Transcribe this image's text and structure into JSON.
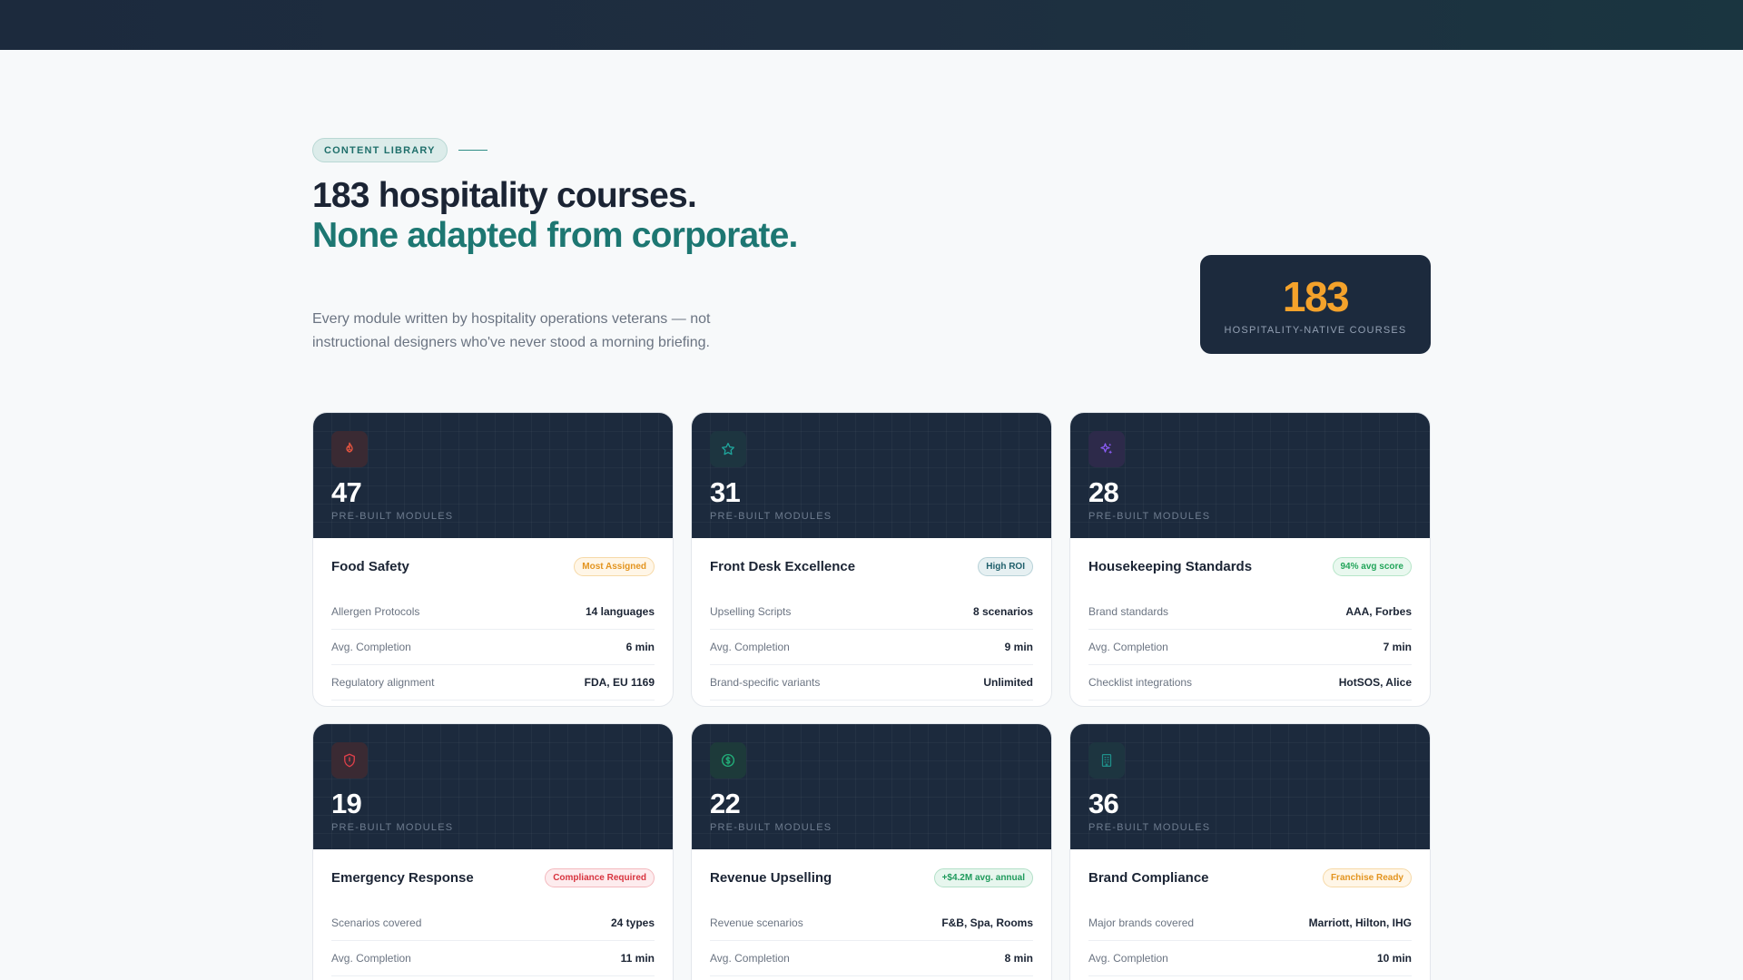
{
  "eyebrow": {
    "label": "CONTENT LIBRARY"
  },
  "headline": {
    "line1": "183 hospitality courses.",
    "line2": "None adapted from corporate."
  },
  "subtext": "Every module written by hospitality operations veterans — not instructional designers who've never stood a morning briefing.",
  "stat": {
    "value": "183",
    "label": "HOSPITALITY-NATIVE COURSES"
  },
  "cards": [
    {
      "icon": "flame-icon",
      "icon_color": "#e0533f",
      "icon_bg": "#3a2a33",
      "count": "47",
      "count_label": "PRE-BUILT MODULES",
      "title": "Food Safety",
      "badge": {
        "text": "Most Assigned",
        "color": "#e3941f",
        "bg": "#fff6e7",
        "border": "#f6d9a7"
      },
      "rows": [
        {
          "label": "Allergen Protocols",
          "value": "14 languages"
        },
        {
          "label": "Avg. Completion",
          "value": "6 min"
        },
        {
          "label": "Regulatory alignment",
          "value": "FDA, EU 1169"
        }
      ]
    },
    {
      "icon": "star-icon",
      "icon_color": "#1fa39a",
      "icon_bg": "#1d3540",
      "count": "31",
      "count_label": "PRE-BUILT MODULES",
      "title": "Front Desk Excellence",
      "badge": {
        "text": "High ROI",
        "color": "#1f5f6b",
        "bg": "#e6f0f2",
        "border": "#b8d2d8"
      },
      "rows": [
        {
          "label": "Upselling Scripts",
          "value": "8 scenarios"
        },
        {
          "label": "Avg. Completion",
          "value": "9 min"
        },
        {
          "label": "Brand-specific variants",
          "value": "Unlimited"
        }
      ]
    },
    {
      "icon": "sparkle-icon",
      "icon_color": "#8b5cf6",
      "icon_bg": "#2d2a4a",
      "count": "28",
      "count_label": "PRE-BUILT MODULES",
      "title": "Housekeeping Standards",
      "badge": {
        "text": "94% avg score",
        "color": "#22a55a",
        "bg": "#e9f8ef",
        "border": "#b6e5c8"
      },
      "rows": [
        {
          "label": "Brand standards",
          "value": "AAA, Forbes"
        },
        {
          "label": "Avg. Completion",
          "value": "7 min"
        },
        {
          "label": "Checklist integrations",
          "value": "HotSOS, Alice"
        }
      ]
    },
    {
      "icon": "shield-icon",
      "icon_color": "#e0404a",
      "icon_bg": "#3a2a33",
      "count": "19",
      "count_label": "PRE-BUILT MODULES",
      "title": "Emergency Response",
      "badge": {
        "text": "Compliance Required",
        "color": "#d8343f",
        "bg": "#fdecee",
        "border": "#f3b9be"
      },
      "rows": [
        {
          "label": "Scenarios covered",
          "value": "24 types"
        },
        {
          "label": "Avg. Completion",
          "value": "11 min"
        }
      ]
    },
    {
      "icon": "dollar-icon",
      "icon_color": "#22b07a",
      "icon_bg": "#1d3a3a",
      "count": "22",
      "count_label": "PRE-BUILT MODULES",
      "title": "Revenue Upselling",
      "badge": {
        "text": "+$4.2M avg. annual",
        "color": "#1f9a5c",
        "bg": "#e7f6ee",
        "border": "#b3e0c8"
      },
      "rows": [
        {
          "label": "Revenue scenarios",
          "value": "F&B, Spa, Rooms"
        },
        {
          "label": "Avg. Completion",
          "value": "8 min"
        }
      ]
    },
    {
      "icon": "building-icon",
      "icon_color": "#1f8f8a",
      "icon_bg": "#1d3540",
      "count": "36",
      "count_label": "PRE-BUILT MODULES",
      "title": "Brand Compliance",
      "badge": {
        "text": "Franchise Ready",
        "color": "#e3941f",
        "bg": "#fff6e7",
        "border": "#f6d9a7"
      },
      "rows": [
        {
          "label": "Major brands covered",
          "value": "Marriott, Hilton, IHG"
        },
        {
          "label": "Avg. Completion",
          "value": "10 min"
        }
      ]
    }
  ]
}
